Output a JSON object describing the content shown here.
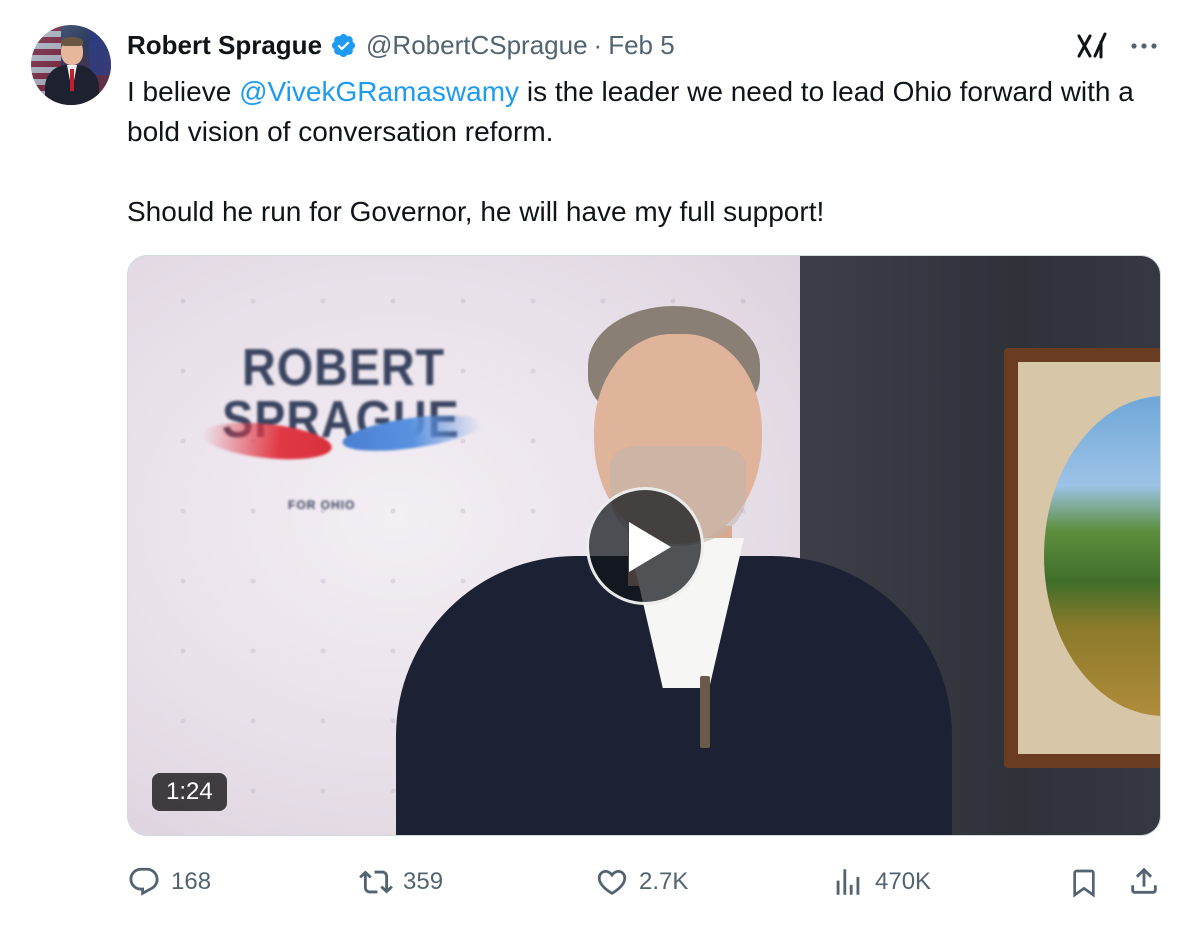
{
  "author": {
    "name": "Robert Sprague",
    "handle": "@RobertCSprague",
    "separator": "·",
    "date": "Feb 5",
    "verified": true,
    "verified_color": "#1d9bf0"
  },
  "tweet": {
    "line1_prefix": "I believe ",
    "mention": "@VivekGRamaswamy",
    "line1_suffix": " is the leader we need to lead Ohio forward with a bold vision of conversation reform.",
    "line2": "Should he run for Governor, he will have my full support!"
  },
  "media": {
    "type": "video",
    "duration": "1:24",
    "banner_line1": "ROBERT",
    "banner_line2": "SPRAGUE",
    "banner_sub": "FOR OHIO"
  },
  "actions": {
    "replies": "168",
    "reposts": "359",
    "likes": "2.7K",
    "views": "470K"
  },
  "icons": [
    "grok-icon",
    "more-icon",
    "reply-icon",
    "repost-icon",
    "like-icon",
    "views-icon",
    "bookmark-icon",
    "share-icon",
    "play-icon",
    "verified-icon"
  ],
  "colors": {
    "accent": "#1d9bf0",
    "text": "#0f1419",
    "secondary": "#536471"
  }
}
